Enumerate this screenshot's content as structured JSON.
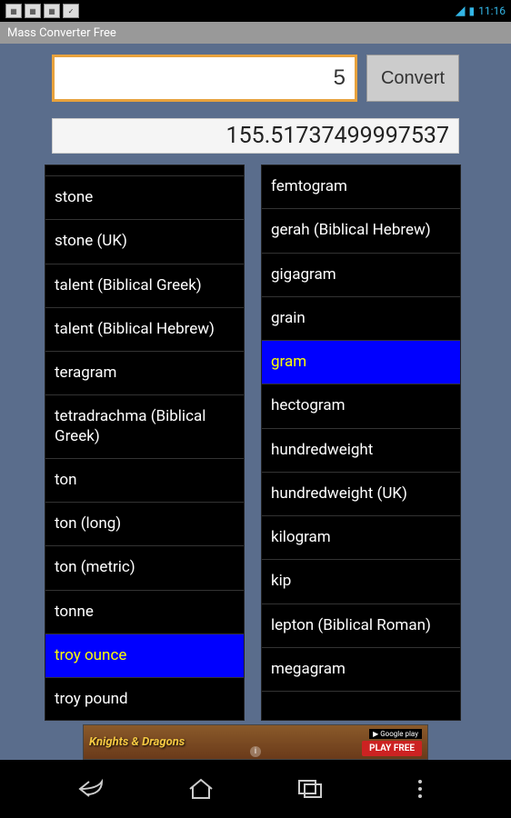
{
  "status": {
    "time": "11:16"
  },
  "app": {
    "title": "Mass Converter Free"
  },
  "input": {
    "value": "5",
    "convert_label": "Convert"
  },
  "result": {
    "value": "155.51737499997537"
  },
  "from_list": [
    "stone",
    "stone (UK)",
    "talent (Biblical Greek)",
    "talent (Biblical Hebrew)",
    "teragram",
    "tetradrachma (Biblical Greek)",
    "ton",
    "ton (long)",
    "ton (metric)",
    "tonne",
    "troy ounce",
    "troy pound"
  ],
  "from_selected": "troy ounce",
  "to_list": [
    "femtogram",
    "gerah (Biblical Hebrew)",
    "gigagram",
    "grain",
    "gram",
    "hectogram",
    "hundredweight",
    "hundredweight (UK)",
    "kilogram",
    "kip",
    "lepton (Biblical Roman)",
    "megagram"
  ],
  "to_selected": "gram",
  "ad": {
    "title": "Knights & Dragons",
    "store": "Google play",
    "cta": "PLAY FREE"
  }
}
